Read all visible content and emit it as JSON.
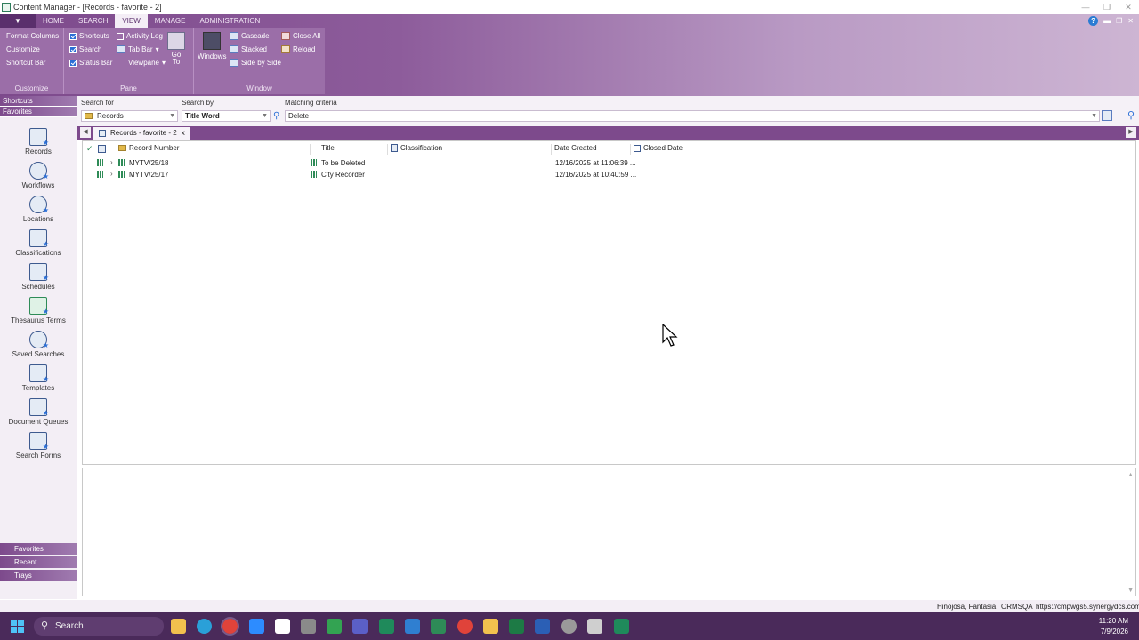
{
  "window": {
    "title": "Content Manager - [Records - favorite - 2]"
  },
  "ribbon": {
    "tabs": [
      "HOME",
      "SEARCH",
      "VIEW",
      "MANAGE",
      "ADMINISTRATION"
    ],
    "active_tab": "VIEW",
    "customize_group": {
      "label": "Customize",
      "items": [
        "Format Columns",
        "Customize",
        "Shortcut Bar"
      ]
    },
    "pane_group": {
      "label": "Pane",
      "checkboxes": [
        {
          "label": "Shortcuts",
          "checked": true
        },
        {
          "label": "Search",
          "checked": true
        },
        {
          "label": "Status Bar",
          "checked": true
        },
        {
          "label": "Activity Log",
          "checked": false
        }
      ],
      "dropdowns": [
        "Tab Bar",
        "Viewpane"
      ],
      "goto_label": "Go To"
    },
    "window_group": {
      "label": "Window",
      "windows_label": "Windows",
      "items": [
        "Cascade",
        "Stacked",
        "Side by Side",
        "Close All",
        "Reload"
      ]
    }
  },
  "left_pane": {
    "top_headers": [
      "Shortcuts",
      "Favorites"
    ],
    "items": [
      "Records",
      "Workflows",
      "Locations",
      "Classifications",
      "Schedules",
      "Thesaurus Terms",
      "Saved Searches",
      "Templates",
      "Document Queues",
      "Search Forms"
    ],
    "bottom_headers": [
      "Favorites",
      "Recent",
      "Trays"
    ]
  },
  "search": {
    "search_for_label": "Search for",
    "search_for_value": "Records",
    "search_by_label": "Search by",
    "search_by_value": "Title Word",
    "criteria_label": "Matching criteria",
    "criteria_value": "Delete"
  },
  "doc_tab": {
    "label": "Records - favorite - 2",
    "close": "x"
  },
  "grid": {
    "columns": [
      "Record Number",
      "Title",
      "Classification",
      "Date Created",
      "Closed Date"
    ],
    "rows": [
      {
        "record_number": "MYTV/25/18",
        "title": "To be Deleted",
        "classification": "",
        "date_created": "12/16/2025 at 11:06:39 ...",
        "closed_date": ""
      },
      {
        "record_number": "MYTV/25/17",
        "title": "City Recorder",
        "classification": "",
        "date_created": "12/16/2025 at 10:40:59 ...",
        "closed_date": ""
      }
    ]
  },
  "status_bar": {
    "user": "Hinojosa, Fantasia",
    "dataset": "ORMSQA",
    "url": "https://cmpwgs5.synergydcs.com"
  },
  "taskbar": {
    "search_placeholder": "Search",
    "time": "11:20 AM",
    "date": "7/9/2026"
  },
  "colors": {
    "accent": "#7d4a8c",
    "ribbon_light": "#cdb5d3",
    "checkbox": "#2b6fd6",
    "taskbar": "#4a2a5a"
  }
}
